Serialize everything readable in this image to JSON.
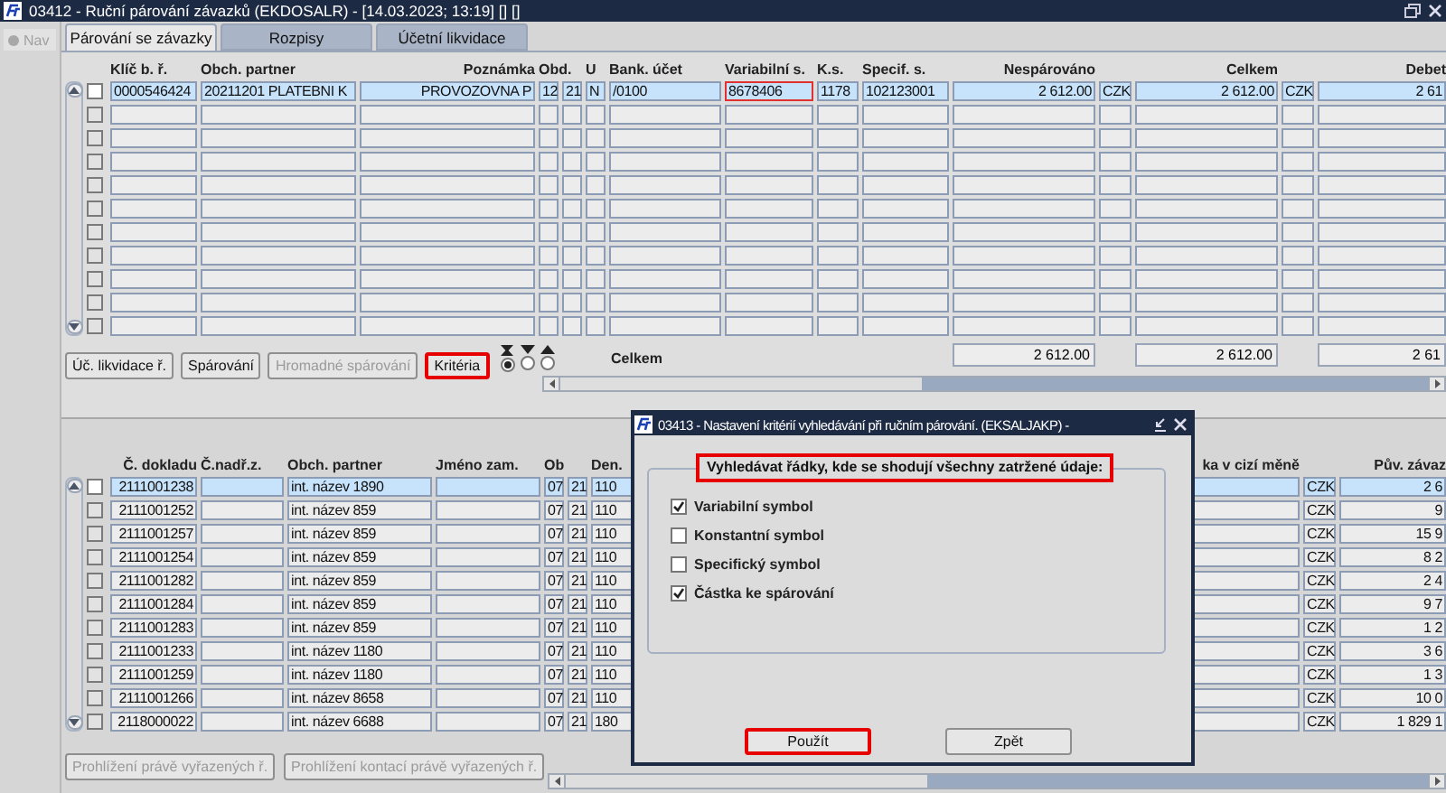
{
  "window": {
    "title": "03412 - Ruční párování závazků (EKDOSALR) - [14.03.2023; 13:19] [] []"
  },
  "nav": {
    "label": "Nav",
    "disabled": true
  },
  "tabs": [
    {
      "label": "Párování se závazky",
      "selected": true
    },
    {
      "label": "Rozpisy",
      "selected": false
    },
    {
      "label": "Účetní likvidace",
      "selected": false
    }
  ],
  "upper_table": {
    "columns": [
      "Klíč b. ř.",
      "Obch. partner",
      "Poznámka",
      "Obd.",
      "U",
      "Bank. účet",
      "Variabilní s.",
      "K.s.",
      "Specif. s.",
      "Nespárováno",
      null,
      "Celkem",
      null,
      "Debet"
    ],
    "rows": [
      {
        "selected": true,
        "checked": false,
        "cells": [
          "0000546424",
          "20211201 PLATEBNI K",
          "PROVOZOVNA P",
          [
            "12",
            "21"
          ],
          "N",
          "/0100",
          {
            "text": "8678406",
            "focused": true
          },
          "1178",
          "102123001",
          "2 612.00",
          "CZK",
          "2 612.00",
          "CZK",
          "2 61"
        ]
      },
      {
        "selected": false,
        "checked": false
      },
      {
        "selected": false,
        "checked": false
      },
      {
        "selected": false,
        "checked": false
      },
      {
        "selected": false,
        "checked": false
      },
      {
        "selected": false,
        "checked": false
      },
      {
        "selected": false,
        "checked": false
      },
      {
        "selected": false,
        "checked": false
      },
      {
        "selected": false,
        "checked": false
      },
      {
        "selected": false,
        "checked": false
      },
      {
        "selected": false,
        "checked": false
      }
    ],
    "totals": {
      "label": "Celkem",
      "unpaired": "2 612.00",
      "total": "2 612.00",
      "debit": "2 61"
    }
  },
  "buttons": [
    {
      "label": "Úč. likvidace ř.",
      "disabled": false,
      "highlighted": false
    },
    {
      "label": "Spárování",
      "disabled": false,
      "highlighted": false
    },
    {
      "label": "Hromadné spárování",
      "disabled": true,
      "highlighted": false
    },
    {
      "label": "Kritéria",
      "disabled": false,
      "highlighted": true
    }
  ],
  "sort_options": [
    {
      "kind": "none",
      "selected": true
    },
    {
      "kind": "descending",
      "selected": false
    },
    {
      "kind": "ascending",
      "selected": false
    }
  ],
  "lower_table": {
    "columns": [
      "Č. dokladu",
      "Č.nadř.z.",
      "Obch. partner",
      "Jméno zam.",
      "Ob",
      "Den.",
      null,
      "ka v cizí měně",
      null,
      "Pův. závaz"
    ],
    "rows": [
      {
        "selected": true,
        "checked": false,
        "cells": [
          "2111001238",
          null,
          "int. název 1890",
          null,
          [
            "07",
            "21"
          ],
          "110",
          null,
          null,
          "CZK",
          "2 6"
        ]
      },
      {
        "selected": false,
        "checked": false,
        "cells": [
          "2111001252",
          null,
          "int. název 859",
          null,
          [
            "07",
            "21"
          ],
          "110",
          null,
          null,
          "CZK",
          "9"
        ]
      },
      {
        "selected": false,
        "checked": false,
        "cells": [
          "2111001257",
          null,
          "int. název 859",
          null,
          [
            "07",
            "21"
          ],
          "110",
          null,
          null,
          "CZK",
          "15 9"
        ]
      },
      {
        "selected": false,
        "checked": false,
        "cells": [
          "2111001254",
          null,
          "int. název 859",
          null,
          [
            "07",
            "21"
          ],
          "110",
          null,
          null,
          "CZK",
          "8 2"
        ]
      },
      {
        "selected": false,
        "checked": false,
        "cells": [
          "2111001282",
          null,
          "int. název 859",
          null,
          [
            "07",
            "21"
          ],
          "110",
          null,
          null,
          "CZK",
          "2 4"
        ]
      },
      {
        "selected": false,
        "checked": false,
        "cells": [
          "2111001284",
          null,
          "int. název 859",
          null,
          [
            "07",
            "21"
          ],
          "110",
          null,
          null,
          "CZK",
          "9 7"
        ]
      },
      {
        "selected": false,
        "checked": false,
        "cells": [
          "2111001283",
          null,
          "int. název 859",
          null,
          [
            "07",
            "21"
          ],
          "110",
          null,
          null,
          "CZK",
          "1 2"
        ]
      },
      {
        "selected": false,
        "checked": false,
        "cells": [
          "2111001233",
          null,
          "int. název 1180",
          null,
          [
            "07",
            "21"
          ],
          "110",
          null,
          null,
          "CZK",
          "3 6"
        ]
      },
      {
        "selected": false,
        "checked": false,
        "cells": [
          "2111001259",
          null,
          "int. název 1180",
          null,
          [
            "07",
            "21"
          ],
          "110",
          null,
          null,
          "CZK",
          "1 3"
        ]
      },
      {
        "selected": false,
        "checked": false,
        "cells": [
          "2111001266",
          null,
          "int. název 8658",
          null,
          [
            "07",
            "21"
          ],
          "110",
          null,
          null,
          "CZK",
          "10 0"
        ]
      },
      {
        "selected": false,
        "checked": false,
        "cells": [
          "2118000022",
          null,
          "int. název 6688",
          null,
          [
            "07",
            "21"
          ],
          "180",
          null,
          null,
          "CZK",
          "1 829 1"
        ]
      }
    ]
  },
  "lower_buttons": [
    {
      "label": "Prohlížení právě vyřazených ř.",
      "disabled": true
    },
    {
      "label": "Prohlížení kontací právě vyřazených ř.",
      "disabled": true
    }
  ],
  "dialog": {
    "title": "03413 - Nastavení kritérií vyhledávání při ručním párování. (EKSALJAKP) -",
    "group_label": "Vyhledávat řádky, kde se shodují všechny zatržené údaje:",
    "group_label_highlighted": true,
    "options": [
      {
        "label": "Variabilní symbol",
        "checked": true
      },
      {
        "label": "Konstantní symbol",
        "checked": false
      },
      {
        "label": "Specifický symbol",
        "checked": false
      },
      {
        "label": "Částka ke spárování",
        "checked": true
      }
    ],
    "buttons": [
      {
        "label": "Použít",
        "highlighted": true
      },
      {
        "label": "Zpět",
        "highlighted": false
      }
    ]
  }
}
